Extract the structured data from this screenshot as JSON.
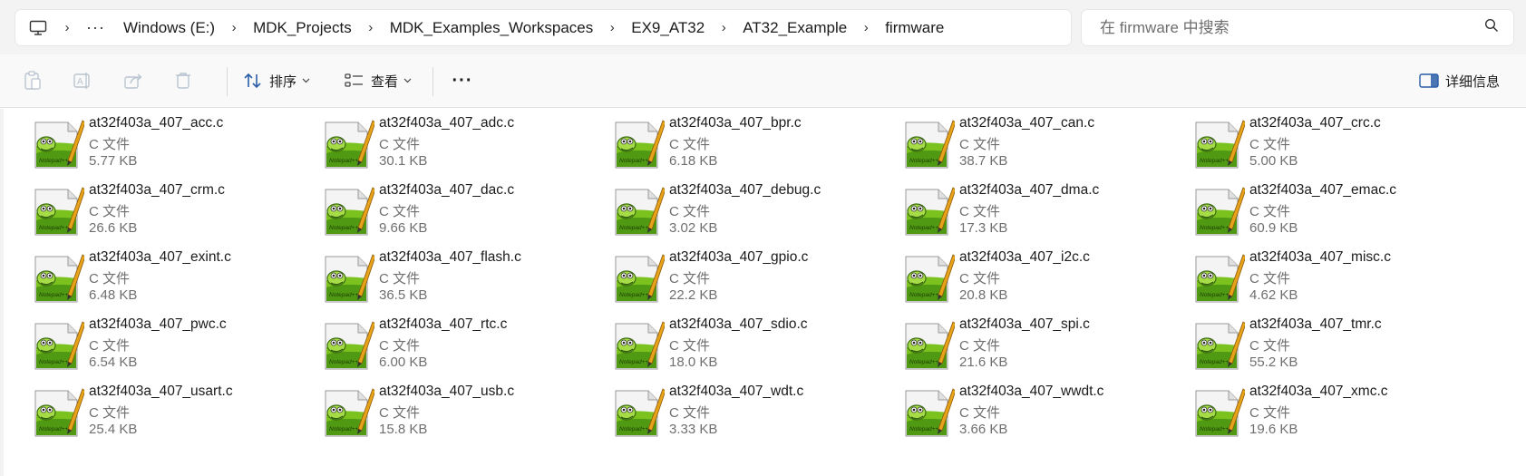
{
  "breadcrumb": {
    "items": [
      "Windows (E:)",
      "MDK_Projects",
      "MDK_Examples_Workspaces",
      "EX9_AT32",
      "AT32_Example",
      "firmware"
    ],
    "overflow": "···"
  },
  "search": {
    "placeholder": "在 firmware 中搜索"
  },
  "toolbar": {
    "sort_label": "排序",
    "view_label": "查看",
    "details_label": "详细信息",
    "more_label": "···"
  },
  "files": [
    {
      "name": "at32f403a_407_acc.c",
      "type": "C 文件",
      "size": "5.77 KB"
    },
    {
      "name": "at32f403a_407_adc.c",
      "type": "C 文件",
      "size": "30.1 KB"
    },
    {
      "name": "at32f403a_407_bpr.c",
      "type": "C 文件",
      "size": "6.18 KB"
    },
    {
      "name": "at32f403a_407_can.c",
      "type": "C 文件",
      "size": "38.7 KB"
    },
    {
      "name": "at32f403a_407_crc.c",
      "type": "C 文件",
      "size": "5.00 KB"
    },
    {
      "name": "at32f403a_407_crm.c",
      "type": "C 文件",
      "size": "26.6 KB"
    },
    {
      "name": "at32f403a_407_dac.c",
      "type": "C 文件",
      "size": "9.66 KB"
    },
    {
      "name": "at32f403a_407_debug.c",
      "type": "C 文件",
      "size": "3.02 KB"
    },
    {
      "name": "at32f403a_407_dma.c",
      "type": "C 文件",
      "size": "17.3 KB"
    },
    {
      "name": "at32f403a_407_emac.c",
      "type": "C 文件",
      "size": "60.9 KB"
    },
    {
      "name": "at32f403a_407_exint.c",
      "type": "C 文件",
      "size": "6.48 KB"
    },
    {
      "name": "at32f403a_407_flash.c",
      "type": "C 文件",
      "size": "36.5 KB"
    },
    {
      "name": "at32f403a_407_gpio.c",
      "type": "C 文件",
      "size": "22.2 KB"
    },
    {
      "name": "at32f403a_407_i2c.c",
      "type": "C 文件",
      "size": "20.8 KB"
    },
    {
      "name": "at32f403a_407_misc.c",
      "type": "C 文件",
      "size": "4.62 KB"
    },
    {
      "name": "at32f403a_407_pwc.c",
      "type": "C 文件",
      "size": "6.54 KB"
    },
    {
      "name": "at32f403a_407_rtc.c",
      "type": "C 文件",
      "size": "6.00 KB"
    },
    {
      "name": "at32f403a_407_sdio.c",
      "type": "C 文件",
      "size": "18.0 KB"
    },
    {
      "name": "at32f403a_407_spi.c",
      "type": "C 文件",
      "size": "21.6 KB"
    },
    {
      "name": "at32f403a_407_tmr.c",
      "type": "C 文件",
      "size": "55.2 KB"
    },
    {
      "name": "at32f403a_407_usart.c",
      "type": "C 文件",
      "size": "25.4 KB"
    },
    {
      "name": "at32f403a_407_usb.c",
      "type": "C 文件",
      "size": "15.8 KB"
    },
    {
      "name": "at32f403a_407_wdt.c",
      "type": "C 文件",
      "size": "3.33 KB"
    },
    {
      "name": "at32f403a_407_wwdt.c",
      "type": "C 文件",
      "size": "3.66 KB"
    },
    {
      "name": "at32f403a_407_xmc.c",
      "type": "C 文件",
      "size": "19.6 KB"
    }
  ],
  "icons": {
    "file_icon": "notepad-plus-plus-icon",
    "colors": {
      "accent": "#0067c0",
      "icon_green": "#7cc21f",
      "icon_pencil": "#e8a21a"
    }
  }
}
